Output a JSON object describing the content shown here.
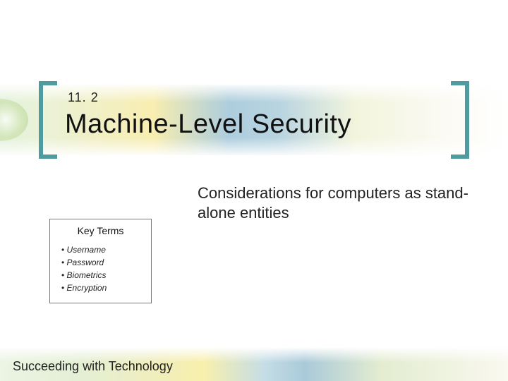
{
  "section_number": "11. 2",
  "section_title": "Machine-Level Security",
  "subtitle": "Considerations for computers as stand-alone entities",
  "keybox": {
    "heading": "Key Terms",
    "items": [
      "Username",
      "Password",
      "Biometrics",
      "Encryption"
    ]
  },
  "footer": "Succeeding with Technology"
}
